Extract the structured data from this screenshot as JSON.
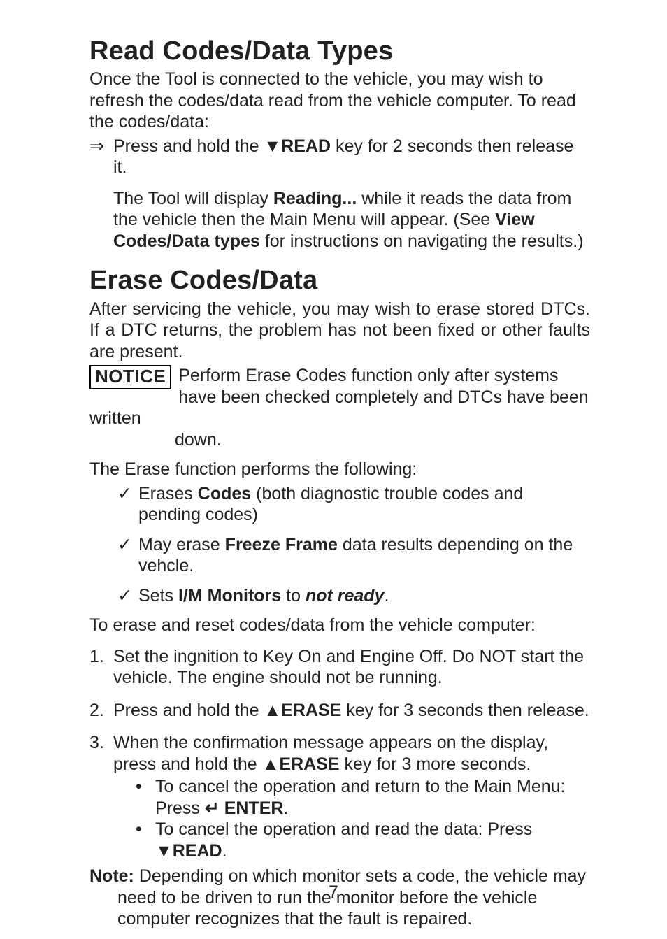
{
  "s1": {
    "title": "Read Codes/Data Types",
    "intro": "Once the Tool is connected to the vehicle, you may wish to refresh the codes/data read from the vehicle computer. To read the codes/data:",
    "arrow_sym": "⇒",
    "arrow_pre": "Press and hold the ",
    "arrow_tri": "▼",
    "arrow_key": "READ",
    "arrow_post": " key for 2 seconds then release it.",
    "detail_a": "The Tool will display ",
    "detail_b": "Reading...",
    "detail_c": " while it reads the data from the vehicle then the Main Menu will appear. (See ",
    "detail_d": "View Codes/Data types",
    "detail_e": " for instructions on navigating the results.)"
  },
  "s2": {
    "title": "Erase Codes/Data",
    "intro": "After servicing the vehicle, you may wish to erase stored DTCs. If a DTC returns, the problem has not been fixed or other faults are present.",
    "notice_label": "NOTICE",
    "notice_text1": "Perform Erase Codes function only after systems have been checked completely and DTCs have been written",
    "notice_text2": "down.",
    "erase_intro": "The Erase function performs the following:",
    "check": "✓",
    "c1a": "Erases ",
    "c1b": "Codes",
    "c1c": " (both diagnostic trouble codes and pending codes)",
    "c2a": "May erase ",
    "c2b": "Freeze Frame",
    "c2c": " data results depending on the vehcle.",
    "c3a": "Sets ",
    "c3b": "I/M Monitors",
    "c3c": " to ",
    "c3d": "not ready",
    "c3e": ".",
    "instr": "To erase and reset codes/data from the vehicle computer:",
    "n1_num": "1.",
    "n1": "Set the ingnition to Key On and Engine Off. Do NOT start the vehicle. The engine should not be running.",
    "n2_num": "2.",
    "n2a": "Press and hold the ",
    "tri_up": "▲",
    "erase_key": "ERASE",
    "n2b": " key for 3 seconds then release.",
    "n3_num": "3.",
    "n3a": "When the confirmation message appears on the display, press and hold the ",
    "n3b": " key for 3 more seconds.",
    "bul": "•",
    "sba": "To cancel the operation and return to the Main Menu: Press ",
    "enter_sym": "↵",
    "enter_lbl": " ENTER",
    "sbb": ".",
    "sca": "To cancel the operation and read the data: Press ",
    "tri_dn": "▼",
    "scb": "READ",
    "scc": ".",
    "note_label": "Note:",
    "note_first": " Depending on which monitor sets a code, the vehicle may",
    "note_rest": "need to be driven to run the monitor before the vehicle computer recognizes that the fault is repaired."
  },
  "page_num": "7"
}
